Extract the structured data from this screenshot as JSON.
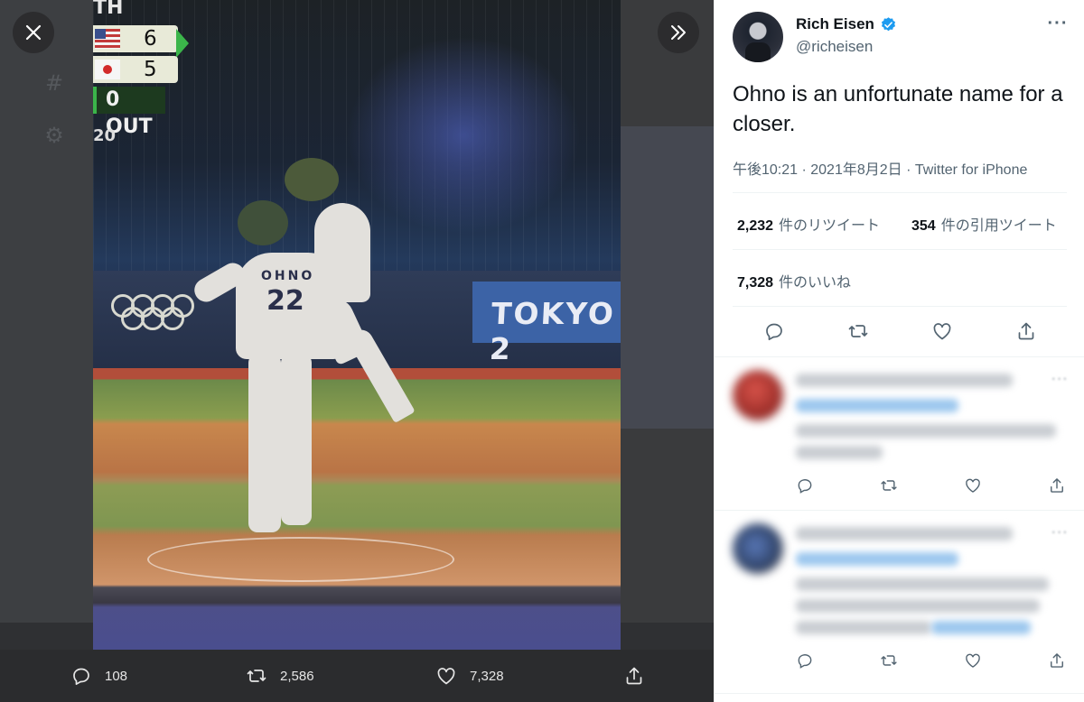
{
  "viewer": {
    "close_icon": "close-icon",
    "expand_icon": "chevron-double-right-icon",
    "photo": {
      "scoreboard_inning_suffix": "TH",
      "teams": [
        {
          "flag": "USA",
          "score": "6"
        },
        {
          "flag": "JPN",
          "score": "5"
        }
      ],
      "outs": "0 OUT",
      "pitch_count": "20",
      "jersey_name": "OHNO",
      "jersey_number": "22",
      "ad_board": "TOKYO 2"
    },
    "media_bar": {
      "reply_count": "108",
      "retweet_count": "2,586",
      "like_count": "7,328"
    }
  },
  "tweet": {
    "author_name": "Rich Eisen",
    "author_handle": "@richeisen",
    "text": "Ohno is an unfortunate name for a closer.",
    "meta": "午後10:21 · 2021年8月2日 · Twitter for iPhone",
    "retweets_value": "2,232",
    "retweets_label": "件のリツイート",
    "quotes_value": "354",
    "quotes_label": "件の引用ツイート",
    "likes_value": "7,328",
    "likes_label": "件のいいね"
  },
  "colors": {
    "verified": "#1d9bf0",
    "text_primary": "#0f1419",
    "text_secondary": "#536471",
    "viewer_bg": "#3a3b3d"
  }
}
